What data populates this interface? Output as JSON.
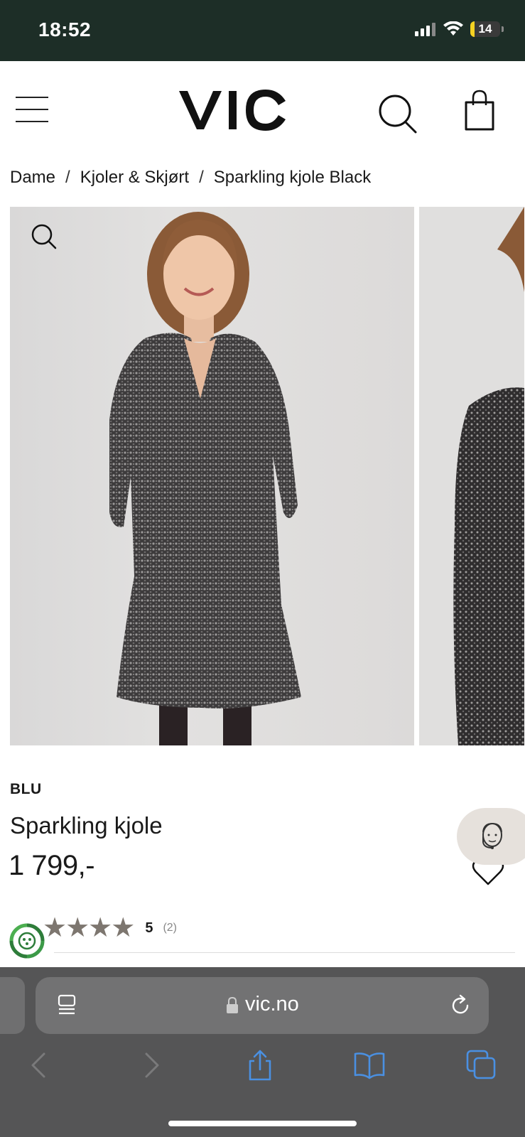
{
  "status_bar": {
    "time": "18:52",
    "battery": "14",
    "battery_level": 0.14
  },
  "header": {
    "logo": "VIC",
    "icons": [
      "hamburger-menu-icon",
      "search-icon",
      "shopping-bag-icon"
    ]
  },
  "breadcrumb": {
    "items": [
      "Dame",
      "Kjoler & Skjørt",
      "Sparkling kjole Black"
    ],
    "separator": "/"
  },
  "gallery": {
    "images": [
      "woman in black sequin wrap dress",
      "side view of sequin dress"
    ],
    "zoom_icon": "zoom-icon"
  },
  "product": {
    "brand": "BLU",
    "title": "Sparkling kjole",
    "price": "1 799,-",
    "rating_value": "5",
    "rating_count": "(2)",
    "stars": 5
  },
  "browser": {
    "url": "vic.no",
    "toolbar_icons": [
      "back-icon",
      "forward-icon",
      "share-icon",
      "bookmarks-icon",
      "tabs-icon"
    ]
  },
  "colors": {
    "status_bg": "#1d2e27",
    "star": "#7d766f",
    "browser_bg": "#555556",
    "accent_blue": "#4a90e2",
    "eco_green": "#2e7d3a"
  }
}
